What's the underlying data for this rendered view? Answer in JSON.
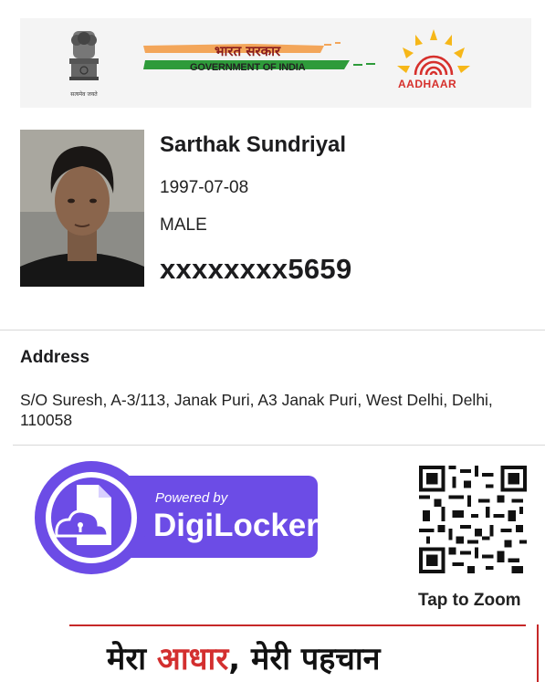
{
  "header": {
    "emblem_caption": "सत्यमेव जयते",
    "gov_hindi": "भारत सरकार",
    "gov_english": "GOVERNMENT OF INDIA",
    "aadhaar_label": "AADHAAR"
  },
  "profile": {
    "name": "Sarthak Sundriyal",
    "dob": "1997-07-08",
    "gender": "MALE",
    "uid_masked": "xxxxxxxx5659"
  },
  "address": {
    "heading": "Address",
    "text": "S/O Suresh, A-3/113, Janak Puri, A3 Janak Puri, West Delhi, Delhi, 110058"
  },
  "digilocker": {
    "powered_by": "Powered by",
    "name": "DigiLocker"
  },
  "qr": {
    "action_label": "Tap to Zoom"
  },
  "footer": {
    "slogan_part1": "मेरा ",
    "slogan_highlight": "आधार",
    "slogan_part2": ", मेरी पहचान"
  },
  "colors": {
    "digilocker_purple": "#6c4ce6",
    "aadhaar_red": "#d6302c",
    "aadhaar_yellow": "#f6b719",
    "saffron": "#f3a65a",
    "green": "#2e9b3a",
    "footer_red": "#c62828"
  }
}
